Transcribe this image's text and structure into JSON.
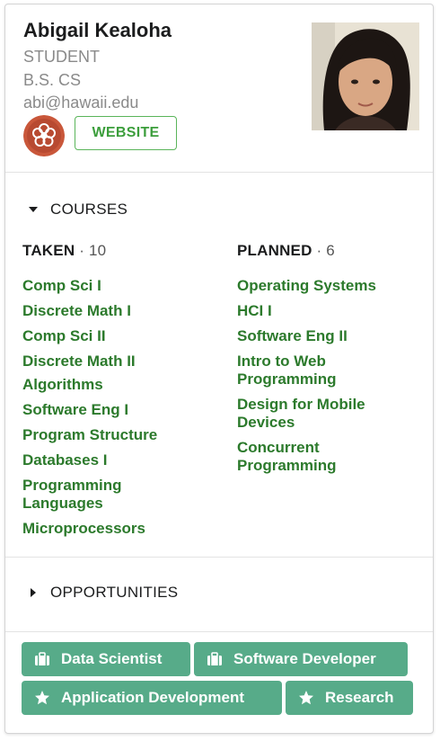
{
  "profile": {
    "name": "Abigail Kealoha",
    "role": "STUDENT",
    "degree": "B.S. CS",
    "email": "abi@hawaii.edu",
    "website_label": "WEBSITE"
  },
  "courses": {
    "section_label": "COURSES",
    "taken": {
      "label": "TAKEN",
      "count": "10",
      "items": [
        "Comp Sci I",
        "Discrete Math I",
        "Comp Sci II",
        "Discrete Math II",
        "Algorithms",
        "Software Eng I",
        "Program Structure",
        "Databases I",
        "Programming Languages",
        "Microprocessors"
      ]
    },
    "planned": {
      "label": "PLANNED",
      "count": "6",
      "items": [
        "Operating Systems",
        "HCI I",
        "Software Eng II",
        "Intro to Web Programming",
        "Design for Mobile Devices",
        "Concurrent Programming"
      ]
    }
  },
  "opportunities": {
    "section_label": "OPPORTUNITIES"
  },
  "tags": [
    {
      "label": "Data Scientist",
      "icon": "briefcase-icon"
    },
    {
      "label": "Software Developer",
      "icon": "briefcase-icon"
    },
    {
      "label": "Application Development",
      "icon": "star-icon"
    },
    {
      "label": "Research",
      "icon": "star-icon"
    }
  ],
  "colors": {
    "course_link": "#2c7a2c",
    "website_border": "#5ab55a",
    "tag_bg": "#57ab89"
  }
}
